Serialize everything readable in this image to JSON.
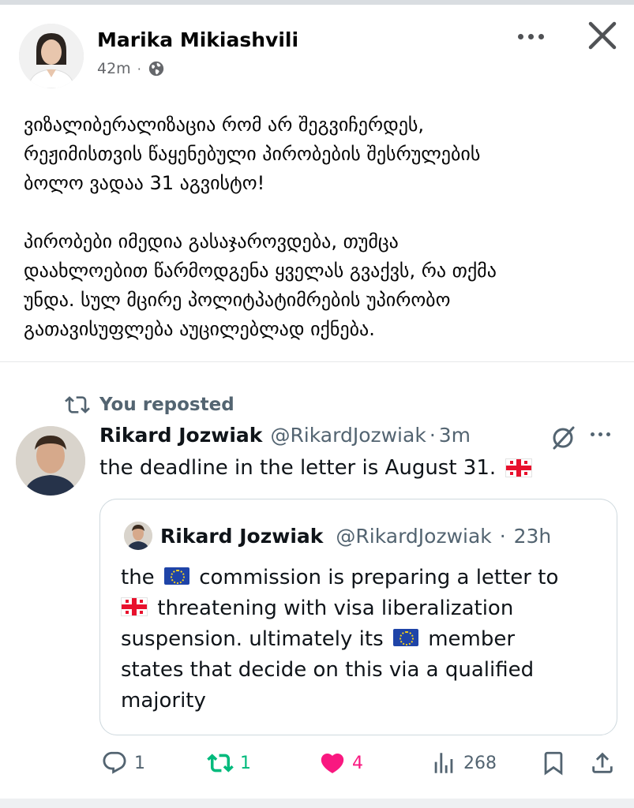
{
  "post": {
    "author": "Marika Mikiashvili",
    "time": "42m",
    "separator": "·",
    "privacy_icon": "globe-icon",
    "paragraphs": [
      "ვიზალიბერალიზაცია რომ არ შეგვიჩერდეს,\nრეჟიმისთვის წაყენებული პირობების შესრულების\nბოლო ვადაა 31 აგვისტო!",
      "პირობები იმედია გასაჯაროვდება, თუმცა\nდაახლოებით წარმოდგენა ყველას გვაქვს, რა თქმა\nუნდა. სულ მცირე პოლიტპატიმრების უპირობო\nგათავისუფლება აუცილებლად იქნება."
    ]
  },
  "tweet": {
    "repost_label": "You reposted",
    "author_name": "Rikard Jozwiak",
    "handle": "@RikardJozwiak",
    "time": "3m",
    "separator": "·",
    "text": "the deadline in the letter is August 31.",
    "quote": {
      "author_name": "Rikard Jozwiak",
      "handle": "@RikardJozwiak",
      "time": "23h",
      "separator": "·",
      "line1_a": "the",
      "line1_b": "commission is preparing a letter to",
      "line2": "threatening with visa liberalization",
      "line3_a": "suspension. ultimately its",
      "line3_b": "member",
      "line4": "states that decide on this via a qualified",
      "line5": "majority"
    },
    "actions": {
      "replies": "1",
      "reposts": "1",
      "likes": "4",
      "views": "268"
    },
    "colors": {
      "repost_active": "#00ba7c",
      "like_active": "#f91880",
      "muted": "#536471"
    }
  }
}
